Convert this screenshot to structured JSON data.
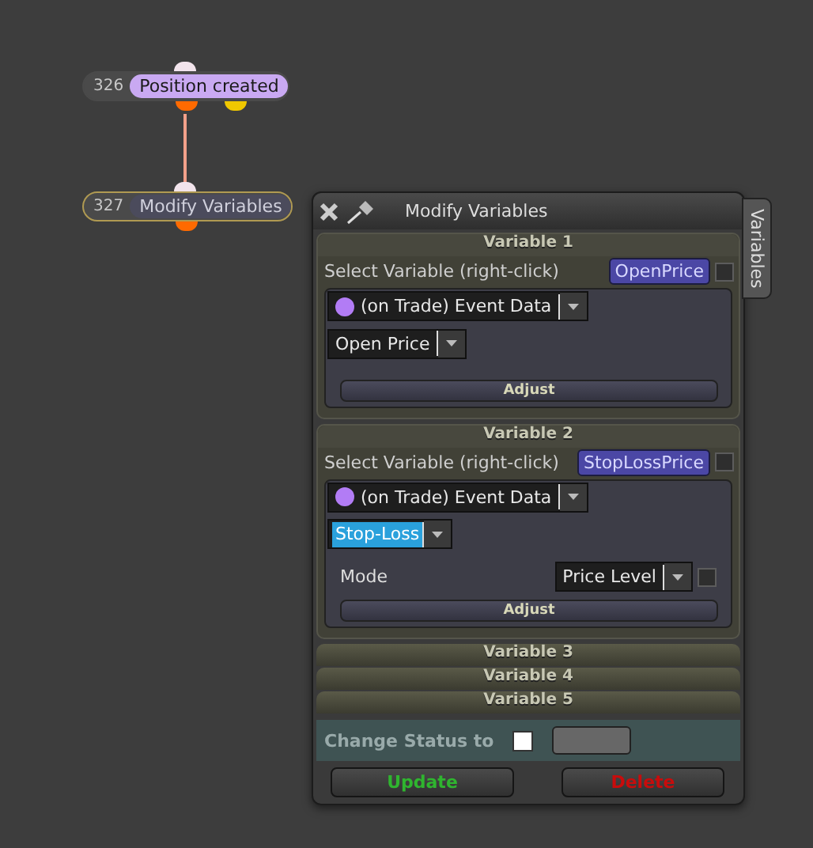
{
  "nodes": [
    {
      "number": "326",
      "label": "Position created",
      "selected": false,
      "color": "#c9a9f2",
      "output_pins": [
        {
          "color": "#ff6a00"
        },
        {
          "color": "#f0c800"
        }
      ]
    },
    {
      "number": "327",
      "label": "Modify Variables",
      "selected": true,
      "color": "#4b4b5c",
      "output_pins": [
        {
          "color": "#ff6a00"
        }
      ]
    }
  ],
  "panel": {
    "title": "Modify Variables",
    "side_tab": "Variables",
    "variables": [
      {
        "title": "Variable 1",
        "expanded": true,
        "select_label": "Select Variable (right-click)",
        "variable_name": "OpenPrice",
        "source": "(on Trade) Event Data",
        "field": "Open Price",
        "field_selected": false,
        "adjust": "Adjust"
      },
      {
        "title": "Variable 2",
        "expanded": true,
        "select_label": "Select Variable (right-click)",
        "variable_name": "StopLossPrice",
        "source": "(on Trade) Event Data",
        "field": "Stop-Loss",
        "field_selected": true,
        "mode": {
          "label": "Mode",
          "value": "Price Level"
        },
        "adjust": "Adjust"
      },
      {
        "title": "Variable 3",
        "expanded": false
      },
      {
        "title": "Variable 4",
        "expanded": false
      },
      {
        "title": "Variable 5",
        "expanded": false
      }
    ],
    "status": {
      "label": "Change Status to",
      "checked": false
    },
    "buttons": [
      {
        "label": "Update",
        "color": "#2fb52f"
      },
      {
        "label": "Delete",
        "color": "#c80c0c"
      }
    ]
  }
}
